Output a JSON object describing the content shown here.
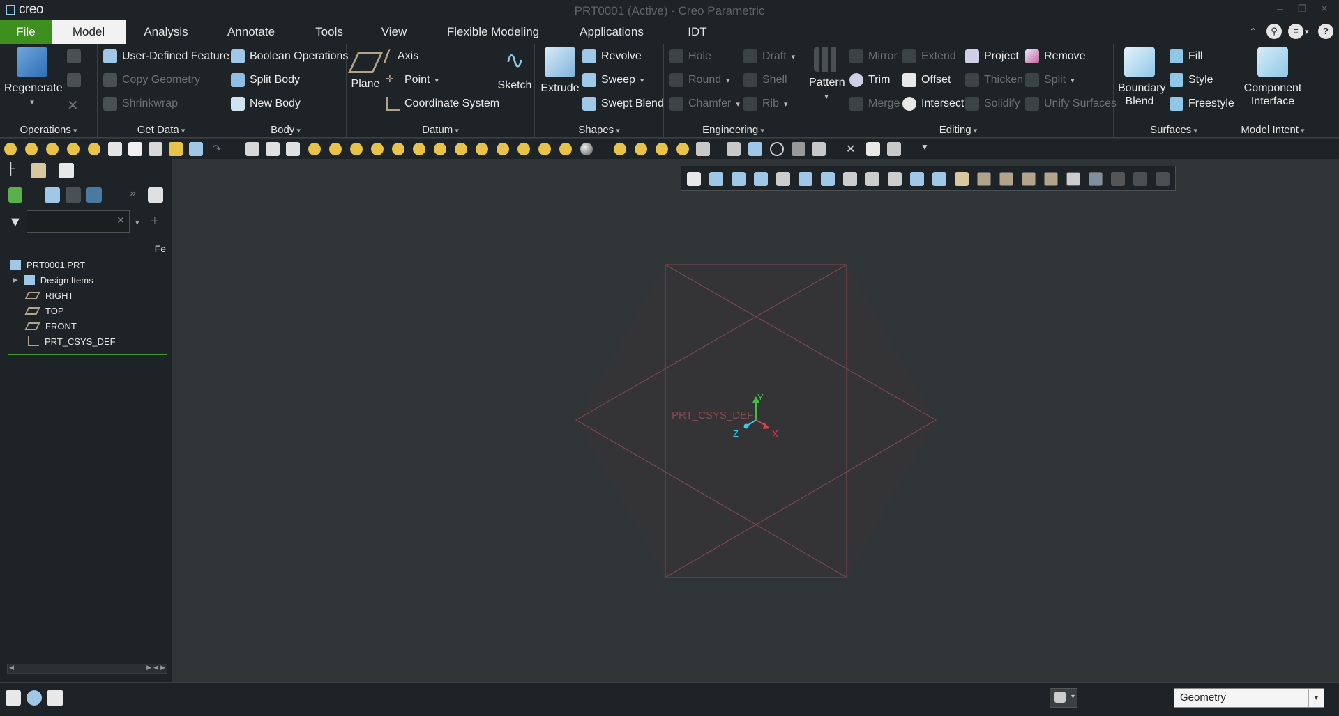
{
  "window": {
    "logo": "creo",
    "title": "PRT0001 (Active) - Creo Parametric"
  },
  "menu": {
    "tabs": [
      "File",
      "Model",
      "Analysis",
      "Annotate",
      "Tools",
      "View",
      "Flexible Modeling",
      "Applications",
      "IDT"
    ],
    "active": "Model"
  },
  "ribbon": {
    "operations": {
      "regenerate": "Regenerate",
      "label": "Operations"
    },
    "get_data": {
      "items": [
        "User-Defined Feature",
        "Copy Geometry",
        "Shrinkwrap"
      ],
      "label": "Get Data"
    },
    "body": {
      "items": [
        "Boolean Operations",
        "Split Body",
        "New Body"
      ],
      "label": "Body"
    },
    "datum": {
      "plane": "Plane",
      "items": [
        "Axis",
        "Point",
        "Coordinate System"
      ],
      "sketch": "Sketch",
      "label": "Datum"
    },
    "shapes": {
      "extrude": "Extrude",
      "items": [
        "Revolve",
        "Sweep",
        "Swept Blend"
      ],
      "label": "Shapes"
    },
    "engineering": {
      "items": [
        "Hole",
        "Round",
        "Chamfer",
        "Draft",
        "Shell",
        "Rib"
      ],
      "label": "Engineering"
    },
    "editing": {
      "pattern": "Pattern",
      "items": [
        "Mirror",
        "Trim",
        "Merge",
        "Extend",
        "Offset",
        "Intersect",
        "Project",
        "Thicken",
        "Solidify",
        "Remove",
        "Split",
        "Unify Surfaces"
      ],
      "label": "Editing"
    },
    "surfaces": {
      "boundary_blend": "Boundary Blend",
      "items": [
        "Fill",
        "Style",
        "Freestyle"
      ],
      "label": "Surfaces"
    },
    "model_intent": {
      "component_interface": "Component Interface",
      "label": "Model Intent"
    }
  },
  "tree": {
    "column_header": "Fe",
    "items": [
      "PRT0001.PRT",
      "Design Items",
      "RIGHT",
      "TOP",
      "FRONT",
      "PRT_CSYS_DEF"
    ]
  },
  "graphics": {
    "csys_label": "PRT_CSYS_DEF",
    "axis_y": "Y",
    "axis_x": "X",
    "axis_z": "Z"
  },
  "status": {
    "selection_filter": "Geometry"
  },
  "colors": {
    "accent_file": "#3d8f1e",
    "datum_plane": "#8a4a52",
    "axis_x": "#e04040",
    "axis_y": "#40c040",
    "axis_z": "#40c8e8"
  }
}
